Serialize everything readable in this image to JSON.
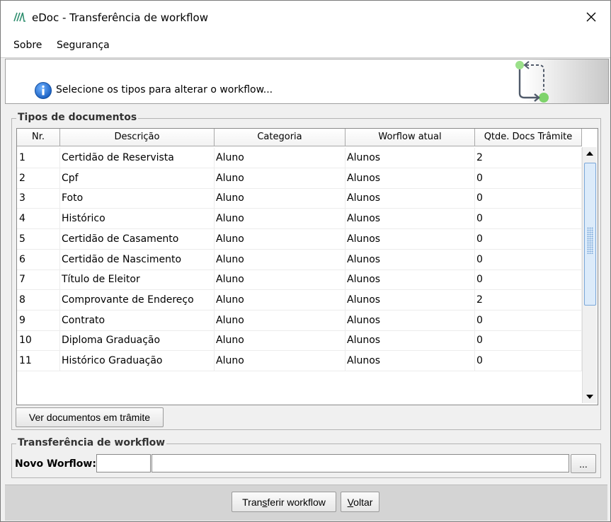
{
  "window": {
    "title": "eDoc - Transferência de workflow"
  },
  "menu": {
    "items": [
      {
        "label": "Sobre"
      },
      {
        "label": "Segurança"
      }
    ]
  },
  "header": {
    "message": "Selecione os tipos para alterar o workflow..."
  },
  "documents_group": {
    "legend": "Tipos de documentos",
    "columns": [
      "Nr.",
      "Descrição",
      "Categoria",
      "Worflow atual",
      "Qtde. Docs Trâmite"
    ],
    "rows": [
      [
        "1",
        "Certidão de Reservista",
        "Aluno",
        "Alunos",
        "2"
      ],
      [
        "2",
        "Cpf",
        "Aluno",
        "Alunos",
        "0"
      ],
      [
        "3",
        "Foto",
        "Aluno",
        "Alunos",
        "0"
      ],
      [
        "4",
        "Histórico",
        "Aluno",
        "Alunos",
        "0"
      ],
      [
        "5",
        "Certidão de Casamento",
        "Aluno",
        "Alunos",
        "0"
      ],
      [
        "6",
        "Certidão de Nascimento",
        "Aluno",
        "Alunos",
        "0"
      ],
      [
        "7",
        "Título de Eleitor",
        "Aluno",
        "Alunos",
        "0"
      ],
      [
        "8",
        "Comprovante de Endereço",
        "Aluno",
        "Alunos",
        "2"
      ],
      [
        "9",
        "Contrato",
        "Aluno",
        "Alunos",
        "0"
      ],
      [
        "10",
        "Diploma Graduação",
        "Aluno",
        "Alunos",
        "0"
      ],
      [
        "11",
        "Histórico Graduação",
        "Aluno",
        "Alunos",
        "0"
      ]
    ],
    "view_button": "Ver documentos em trâmite"
  },
  "transfer_group": {
    "legend": "Transferência de workflow",
    "label": "Novo Worflow:",
    "code_value": "",
    "name_value": "",
    "browse_button": "..."
  },
  "footer": {
    "transfer_prefix": "Tran",
    "transfer_mnemonic": "s",
    "transfer_suffix": "ferir workflow",
    "back_mnemonic": "V",
    "back_suffix": "oltar"
  },
  "icons": {
    "app": "edoc-logo-icon",
    "close": "close-icon",
    "info": "info-icon",
    "workflow": "workflow-transfer-icon",
    "scroll_up": "scroll-up-arrow-icon",
    "scroll_down": "scroll-down-arrow-icon"
  },
  "colors": {
    "info_blue": "#1a6fd6",
    "workflow_green": "#7ed36b",
    "accent_blue": "#7aa7d8"
  }
}
